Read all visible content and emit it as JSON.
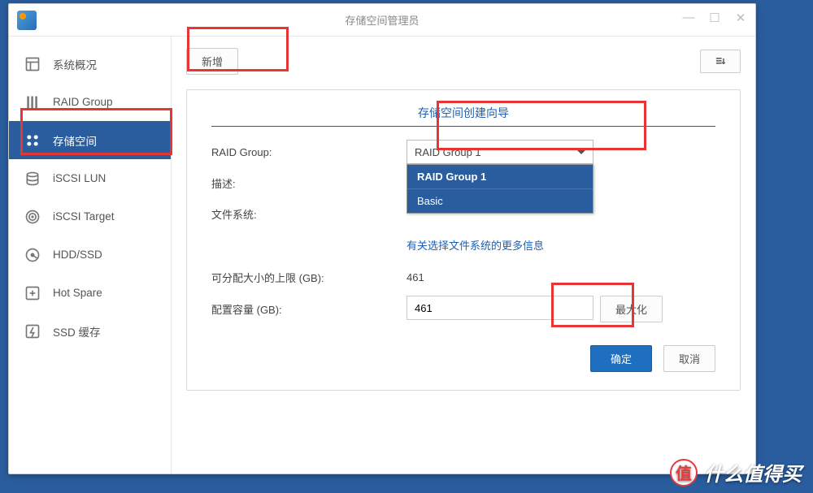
{
  "window": {
    "title": "存储空间管理员"
  },
  "sidebar": {
    "items": [
      {
        "label": "系统概况"
      },
      {
        "label": "RAID Group"
      },
      {
        "label": "存储空间"
      },
      {
        "label": "iSCSI LUN"
      },
      {
        "label": "iSCSI Target"
      },
      {
        "label": "HDD/SSD"
      },
      {
        "label": "Hot Spare"
      },
      {
        "label": "SSD 缓存"
      }
    ]
  },
  "toolbar": {
    "add_label": "新增",
    "sort_glyph": "≡↓"
  },
  "wizard": {
    "title": "存储空间创建向导",
    "fields": {
      "raid_group": "RAID Group:",
      "description": "描述:",
      "filesystem": "文件系统:",
      "fs_link": "有关选择文件系统的更多信息",
      "max_size": "可分配大小的上限 (GB):",
      "alloc_size": "配置容量 (GB):"
    },
    "values": {
      "raid_selected": "RAID Group 1",
      "max_size": "461",
      "alloc_size": "461"
    },
    "dropdown": {
      "opt1": "RAID Group 1",
      "opt2": "Basic"
    },
    "buttons": {
      "maximize": "最大化",
      "ok": "确定",
      "cancel": "取消"
    }
  },
  "watermark": {
    "badge": "值",
    "text": "什么值得买"
  }
}
